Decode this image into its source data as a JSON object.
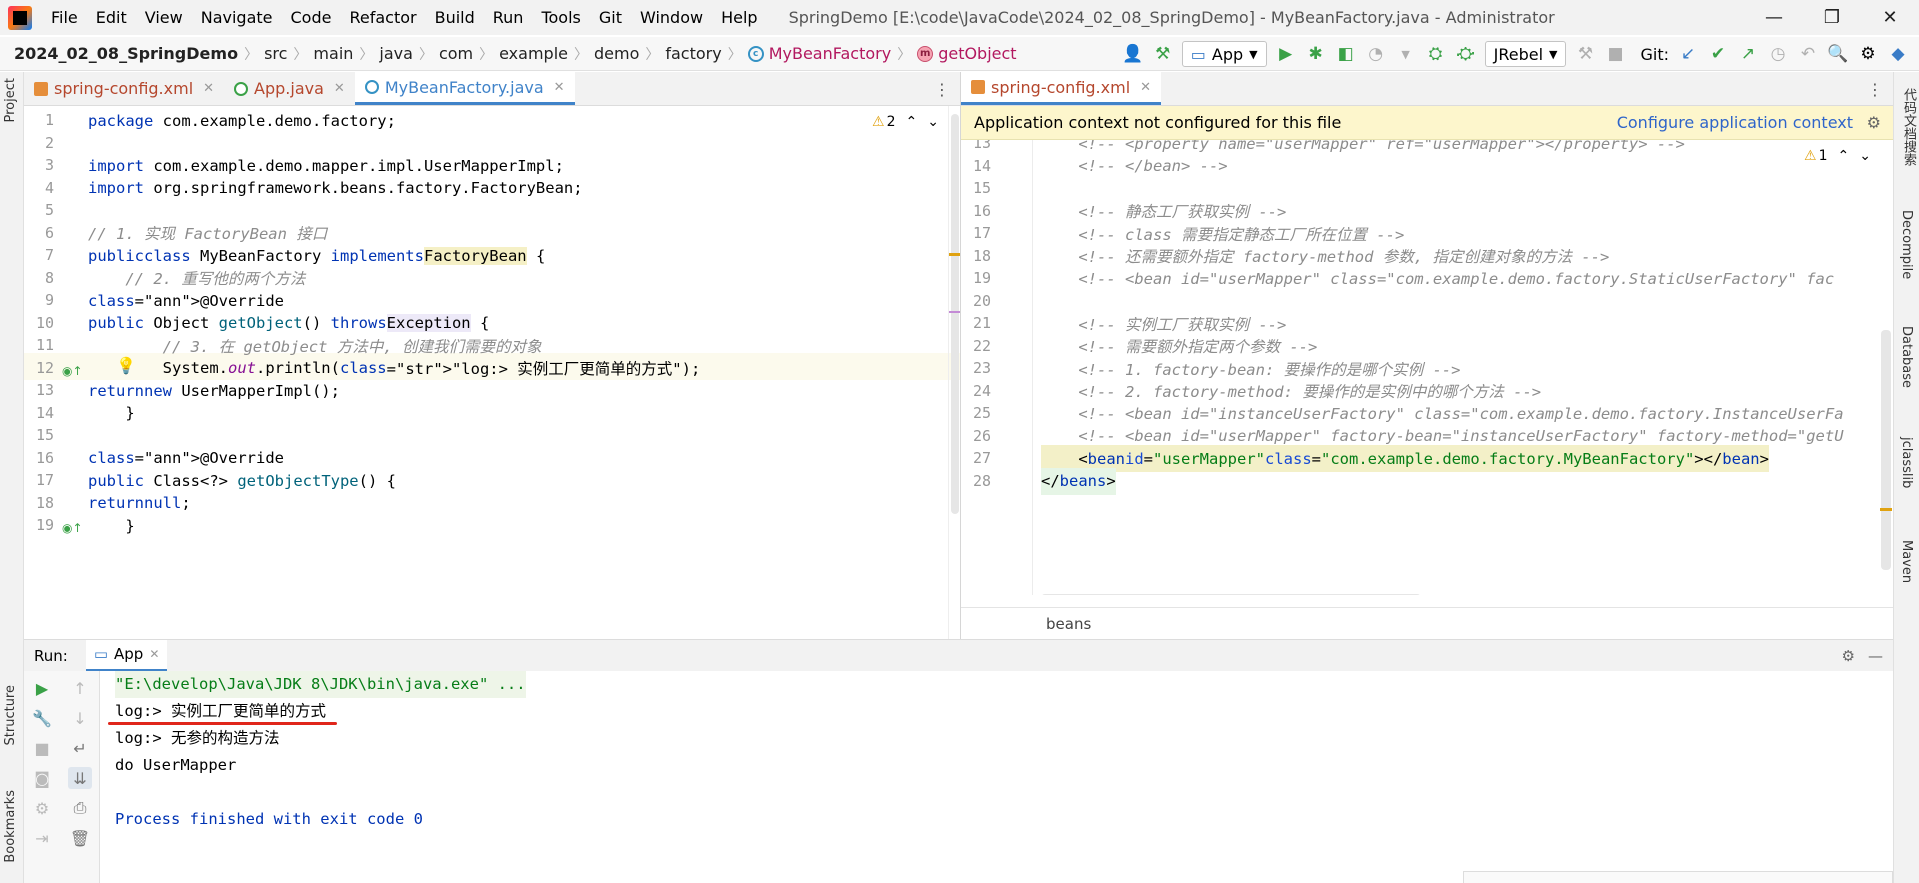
{
  "window": {
    "title": "SpringDemo [E:\\code\\JavaCode\\2024_02_08_SpringDemo] - MyBeanFactory.java - Administrator",
    "menu": [
      "File",
      "Edit",
      "View",
      "Navigate",
      "Code",
      "Refactor",
      "Build",
      "Run",
      "Tools",
      "Git",
      "Window",
      "Help"
    ]
  },
  "breadcrumb": {
    "items": [
      "2024_02_08_SpringDemo",
      "src",
      "main",
      "java",
      "com",
      "example",
      "demo",
      "factory",
      "MyBeanFactory",
      "getObject"
    ]
  },
  "toolbar": {
    "run_config": "App",
    "jrebel": "JRebel",
    "git_label": "Git:"
  },
  "left_tools": [
    "Project",
    "Structure",
    "Bookmarks"
  ],
  "right_tools": [
    "代码文档搜索",
    "Decompile",
    "Database",
    "jclasslib",
    "Maven"
  ],
  "left_tabs": [
    {
      "label": "spring-config.xml"
    },
    {
      "label": "App.java"
    },
    {
      "label": "MyBeanFactory.java"
    }
  ],
  "right_tabs": [
    {
      "label": "spring-config.xml"
    }
  ],
  "left_editor": {
    "warnings": "2",
    "lines": [
      {
        "n": "1",
        "text": "package com.example.demo.factory;"
      },
      {
        "n": "2",
        "text": ""
      },
      {
        "n": "3",
        "text": "import com.example.demo.mapper.impl.UserMapperImpl;"
      },
      {
        "n": "4",
        "text": "import org.springframework.beans.factory.FactoryBean;"
      },
      {
        "n": "5",
        "text": ""
      },
      {
        "n": "6",
        "text": "// 1. 实现 FactoryBean 接口"
      },
      {
        "n": "7",
        "text": "public class MyBeanFactory implements FactoryBean {"
      },
      {
        "n": "8",
        "text": "    // 2. 重写他的两个方法"
      },
      {
        "n": "9",
        "text": "    @Override"
      },
      {
        "n": "10",
        "text": "    public Object getObject() throws Exception {"
      },
      {
        "n": "11",
        "text": "        // 3. 在 getObject 方法中, 创建我们需要的对象"
      },
      {
        "n": "12",
        "text": "        System.out.println(\"log:> 实例工厂更简单的方式\");"
      },
      {
        "n": "13",
        "text": "        return new UserMapperImpl();"
      },
      {
        "n": "14",
        "text": "    }"
      },
      {
        "n": "15",
        "text": ""
      },
      {
        "n": "16",
        "text": "    @Override"
      },
      {
        "n": "17",
        "text": "    public Class<?> getObjectType() {"
      },
      {
        "n": "18",
        "text": "        return null;"
      },
      {
        "n": "19",
        "text": "    }"
      }
    ]
  },
  "right_editor": {
    "banner_text": "Application context not configured for this file",
    "banner_link": "Configure application context",
    "warnings": "1",
    "footer_crumb": "beans",
    "lines": [
      {
        "n": "13",
        "text": "    <!-- <property name=\"userMapper\" ref=\"userMapper\"></property> -->"
      },
      {
        "n": "14",
        "text": "    <!-- </bean> -->"
      },
      {
        "n": "15",
        "text": ""
      },
      {
        "n": "16",
        "text": "    <!-- 静态工厂获取实例 -->"
      },
      {
        "n": "17",
        "text": "    <!-- class 需要指定静态工厂所在位置 -->"
      },
      {
        "n": "18",
        "text": "    <!-- 还需要额外指定 factory-method 参数, 指定创建对象的方法 -->"
      },
      {
        "n": "19",
        "text": "    <!-- <bean id=\"userMapper\" class=\"com.example.demo.factory.StaticUserFactory\" fac"
      },
      {
        "n": "20",
        "text": ""
      },
      {
        "n": "21",
        "text": "    <!-- 实例工厂获取实例 -->"
      },
      {
        "n": "22",
        "text": "    <!-- 需要额外指定两个参数 -->"
      },
      {
        "n": "23",
        "text": "    <!-- 1. factory-bean: 要操作的是哪个实例 -->"
      },
      {
        "n": "24",
        "text": "    <!-- 2. factory-method: 要操作的是实例中的哪个方法 -->"
      },
      {
        "n": "25",
        "text": "    <!-- <bean id=\"instanceUserFactory\" class=\"com.example.demo.factory.InstanceUserFa"
      },
      {
        "n": "26",
        "text": "    <!-- <bean id=\"userMapper\" factory-bean=\"instanceUserFactory\" factory-method=\"getU"
      },
      {
        "n": "27",
        "text": "    <bean id=\"userMapper\" class=\"com.example.demo.factory.MyBeanFactory\"></bean>"
      },
      {
        "n": "28",
        "text": "</beans>"
      }
    ]
  },
  "run_panel": {
    "label": "Run:",
    "tab": "App",
    "output": [
      "\"E:\\develop\\Java\\JDK 8\\JDK\\bin\\java.exe\" ...",
      "log:> 实例工厂更简单的方式",
      "log:> 无参的构造方法",
      "do UserMapper",
      "",
      "Process finished with exit code 0"
    ]
  },
  "colors": {
    "accent": "#4083c9",
    "banner": "#fdf6cc",
    "underline": "#e0261b"
  }
}
